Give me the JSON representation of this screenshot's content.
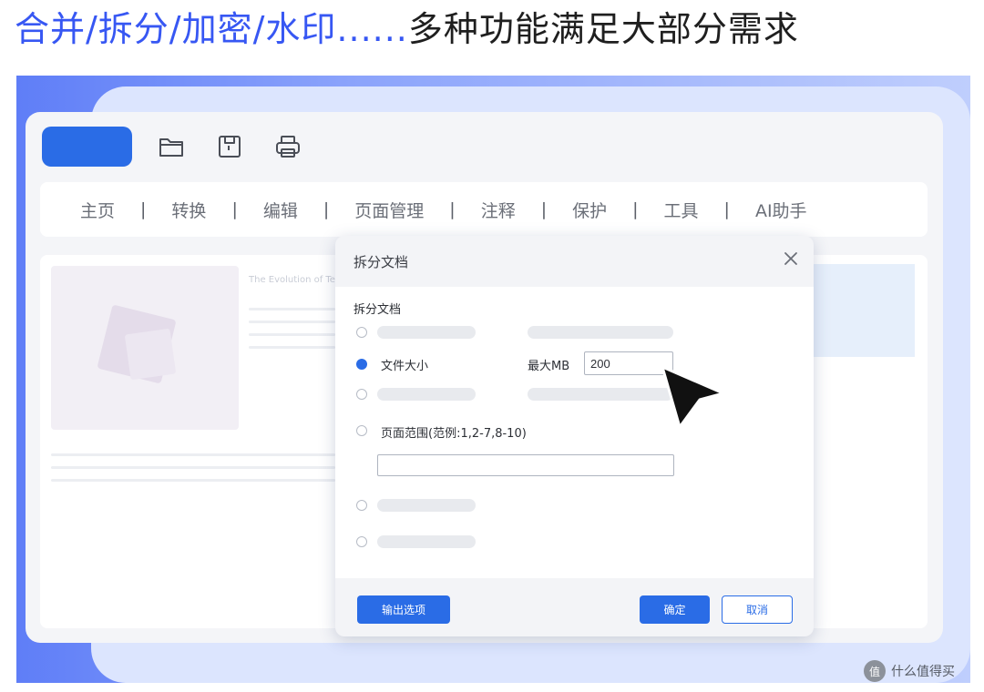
{
  "headline": {
    "accent": "合并/拆分/加密/水印......",
    "rest": "多种功能满足大部分需求"
  },
  "toolbar": {
    "icons": [
      "folder-open-icon",
      "save-icon",
      "print-icon"
    ]
  },
  "menu": {
    "items": [
      "主页",
      "转换",
      "编辑",
      "页面管理",
      "注释",
      "保护",
      "工具",
      "AI助手"
    ],
    "separator": "|"
  },
  "document": {
    "title": "The Evolution of Te"
  },
  "dialog": {
    "title": "拆分文档",
    "section_label": "拆分文档",
    "options": {
      "file_size_label": "文件大小",
      "max_mb_label": "最大MB",
      "max_mb_value": "200",
      "page_range_label": "页面范围(范例:1,2-7,8-10)",
      "page_range_value": ""
    },
    "selected_option": "文件大小",
    "buttons": {
      "output_options": "输出选项",
      "confirm": "确定",
      "cancel": "取消"
    }
  },
  "watermark": {
    "logo": "值",
    "text": "什么值得买"
  },
  "colors": {
    "accent_blue": "#2a6ce6",
    "headline_blue": "#3757f3"
  }
}
